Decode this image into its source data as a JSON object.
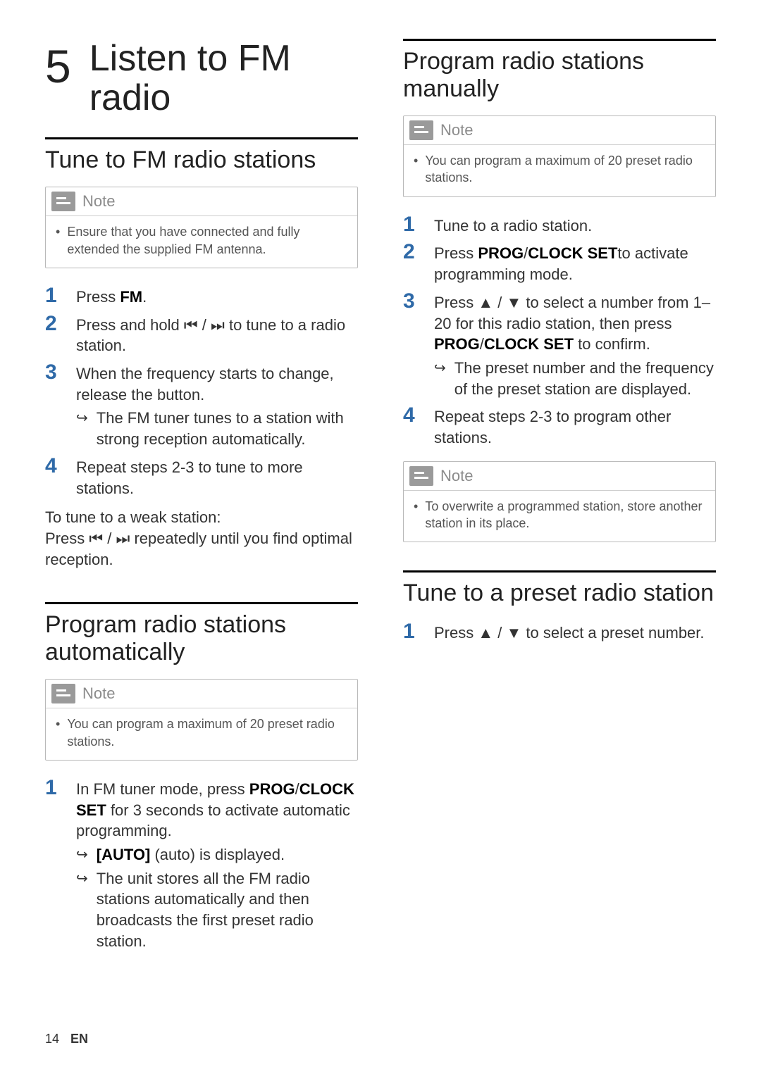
{
  "chapter": {
    "number": "5",
    "title": "Listen to FM radio"
  },
  "left": {
    "section1": {
      "title": "Tune to FM radio stations",
      "note": {
        "label": "Note",
        "body": "Ensure that you have connected and fully extended the supplied FM antenna."
      },
      "steps": {
        "s1": {
          "n": "1",
          "a": "Press ",
          "b": "FM",
          "c": "."
        },
        "s2": {
          "n": "2",
          "a": "Press and hold ",
          "g1": "⏮",
          "sep": " / ",
          "g2": "⏭",
          "c": " to tune to a radio station."
        },
        "s3": {
          "n": "3",
          "text": "When the frequency starts to change, release the button.",
          "sub": "The FM tuner tunes to a station with strong reception automatically."
        },
        "s4": {
          "n": "4",
          "text": "Repeat steps 2-3 to tune to more stations."
        }
      },
      "weak": {
        "title": "To tune to a weak station:",
        "a": "Press ",
        "g1": "⏮",
        "sep": " / ",
        "g2": "⏭",
        "c": " repeatedly until you find optimal reception."
      }
    },
    "section2": {
      "title": "Program radio stations automatically",
      "note": {
        "label": "Note",
        "body": "You can program a maximum of 20 preset radio stations."
      },
      "step1": {
        "n": "1",
        "a": "In FM tuner mode, press ",
        "b": "PROG",
        "slash": "/",
        "c": "CLOCK SET",
        "d": " for 3 seconds to activate automatic programming.",
        "sub1a": "[AUTO]",
        "sub1b": " (auto) is displayed.",
        "sub2": "The unit stores all the FM radio stations automatically and then broadcasts the first preset radio station."
      }
    }
  },
  "right": {
    "section1": {
      "title": "Program radio stations manually",
      "note1": {
        "label": "Note",
        "body": "You can program a maximum of 20 preset radio stations."
      },
      "steps": {
        "s1": {
          "n": "1",
          "text": "Tune to a radio station."
        },
        "s2": {
          "n": "2",
          "a": "Press ",
          "b": "PROG",
          "slash": "/",
          "c": "CLOCK SET",
          "d": "to activate programming mode."
        },
        "s3": {
          "n": "3",
          "a": "Press ",
          "up": "▲",
          "sep": " / ",
          "down": "▼",
          "b": " to select a number from 1–20 for this radio station, then press ",
          "c": "PROG",
          "slash": "/",
          "d": "CLOCK SET",
          "e": " to confirm.",
          "sub": "The preset number and the frequency of the preset station are displayed."
        },
        "s4": {
          "n": "4",
          "text": "Repeat steps 2-3 to program other stations."
        }
      },
      "note2": {
        "label": "Note",
        "body": "To overwrite a programmed station, store another station in its place."
      }
    },
    "section2": {
      "title": "Tune to a preset radio station",
      "step1": {
        "n": "1",
        "a": "Press ",
        "up": "▲",
        "sep": " / ",
        "down": "▼",
        "b": " to select a preset number."
      }
    }
  },
  "footer": {
    "page": "14",
    "lang": "EN"
  },
  "glyphs": {
    "resultArrow": "↪"
  }
}
